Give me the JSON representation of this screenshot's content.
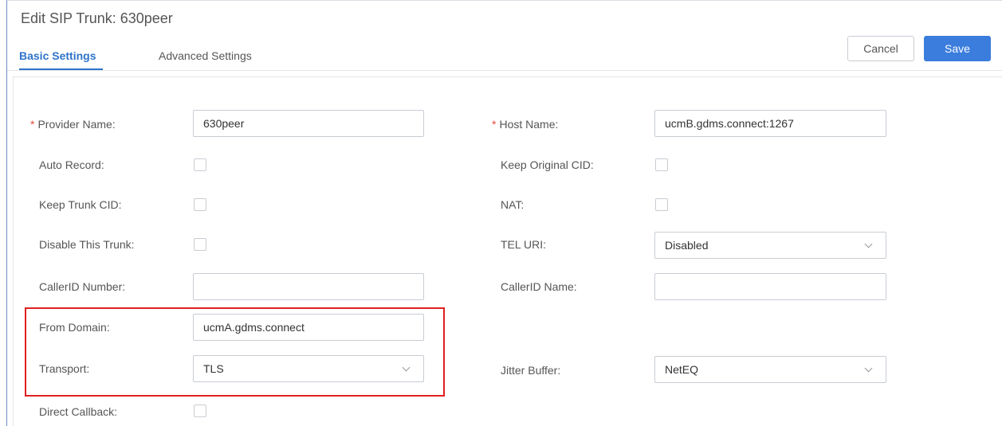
{
  "header": {
    "title": "Edit SIP Trunk: 630peer",
    "tabs": [
      {
        "label": "Basic Settings",
        "active": true
      },
      {
        "label": "Advanced Settings",
        "active": false
      }
    ],
    "cancel_label": "Cancel",
    "save_label": "Save"
  },
  "form": {
    "required_marker": "*",
    "provider_name": {
      "label": "Provider Name:",
      "value": "630peer"
    },
    "host_name": {
      "label": "Host Name:",
      "value": "ucmB.gdms.connect:1267"
    },
    "auto_record": {
      "label": "Auto Record:",
      "checked": false
    },
    "keep_original_cid": {
      "label": "Keep Original CID:",
      "checked": false
    },
    "keep_trunk_cid": {
      "label": "Keep Trunk CID:",
      "checked": false
    },
    "nat": {
      "label": "NAT:",
      "checked": false
    },
    "disable_this_trunk": {
      "label": "Disable This Trunk:",
      "checked": false
    },
    "tel_uri": {
      "label": "TEL URI:",
      "value": "Disabled"
    },
    "callerid_number": {
      "label": "CallerID Number:",
      "value": ""
    },
    "callerid_name": {
      "label": "CallerID Name:",
      "value": ""
    },
    "from_domain": {
      "label": "From Domain:",
      "value": "ucmA.gdms.connect"
    },
    "transport": {
      "label": "Transport:",
      "value": "TLS"
    },
    "jitter_buffer": {
      "label": "Jitter Buffer:",
      "value": "NetEQ"
    },
    "direct_callback": {
      "label": "Direct Callback:",
      "checked": false
    }
  },
  "colors": {
    "accent": "#2e73c9",
    "save_button": "#3b7ddd",
    "required": "#e24c3c",
    "highlight_box": "#e02020"
  }
}
